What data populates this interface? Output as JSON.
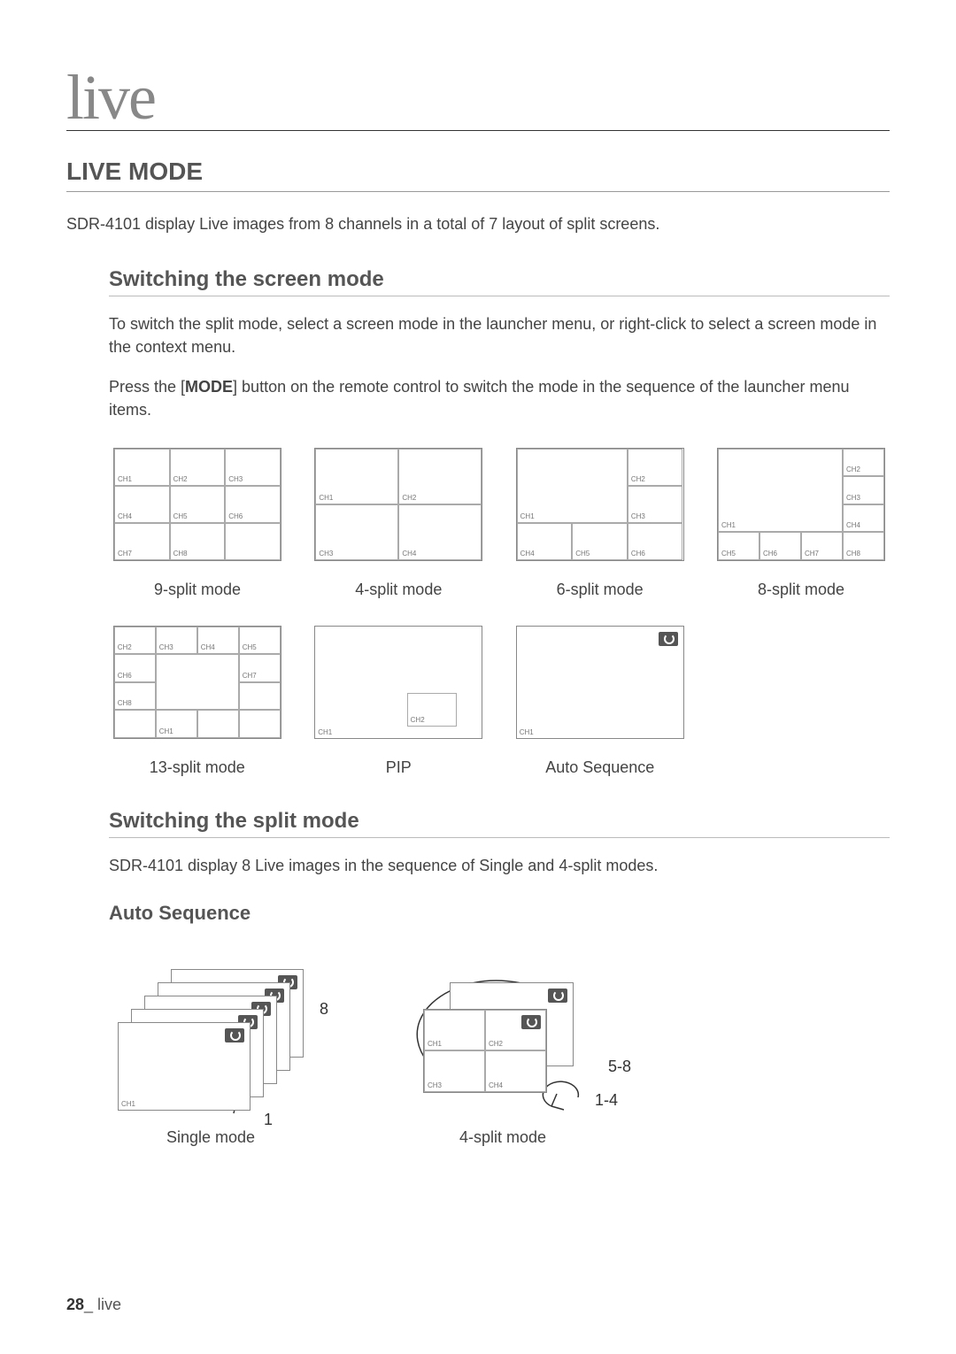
{
  "chapter": "live",
  "h1": "LIVE MODE",
  "intro": "SDR-4101 display Live images from 8 channels in a total of 7 layout of split screens.",
  "section1": {
    "title": "Switching the screen mode",
    "p1": "To switch the split mode, select a screen mode in the launcher menu, or right-click to select a screen mode in the context menu.",
    "p2_pre": "Press the [",
    "p2_bold": "MODE",
    "p2_post": "] button on the remote control to switch the mode in the sequence of the launcher menu items."
  },
  "modes": {
    "nine": {
      "label": "9-split mode",
      "ch": [
        "CH1",
        "CH2",
        "CH3",
        "CH4",
        "CH5",
        "CH6",
        "CH7",
        "CH8"
      ]
    },
    "four": {
      "label": "4-split mode",
      "ch": [
        "CH1",
        "CH2",
        "CH3",
        "CH4"
      ]
    },
    "six": {
      "label": "6-split mode",
      "ch": [
        "CH1",
        "CH2",
        "CH3",
        "CH4",
        "CH5",
        "CH6"
      ]
    },
    "eight": {
      "label": "8-split mode",
      "ch": [
        "CH1",
        "CH2",
        "CH3",
        "CH4",
        "CH5",
        "CH6",
        "CH7",
        "CH8"
      ]
    },
    "thirteen": {
      "label": "13-split mode",
      "ch": [
        "CH1",
        "CH2",
        "CH3",
        "CH4",
        "CH5",
        "CH6",
        "CH7",
        "CH8"
      ]
    },
    "pip": {
      "label": "PIP",
      "ch": [
        "CH1",
        "CH2"
      ]
    },
    "auto": {
      "label": "Auto Sequence",
      "ch": [
        "CH1"
      ]
    }
  },
  "section2": {
    "title": "Switching the split mode",
    "p1": "SDR-4101 display 8 Live images in the sequence of Single and 4-split modes."
  },
  "auto_seq": {
    "title": "Auto Sequence",
    "single": {
      "label": "Single mode",
      "ch": "CH1",
      "start": "1",
      "end": "8"
    },
    "four": {
      "label": "4-split mode",
      "ch": [
        "CH1",
        "CH2",
        "CH3",
        "CH4"
      ],
      "range1": "1-4",
      "range2": "5-8"
    }
  },
  "footer": {
    "page": "28",
    "name": "live"
  }
}
